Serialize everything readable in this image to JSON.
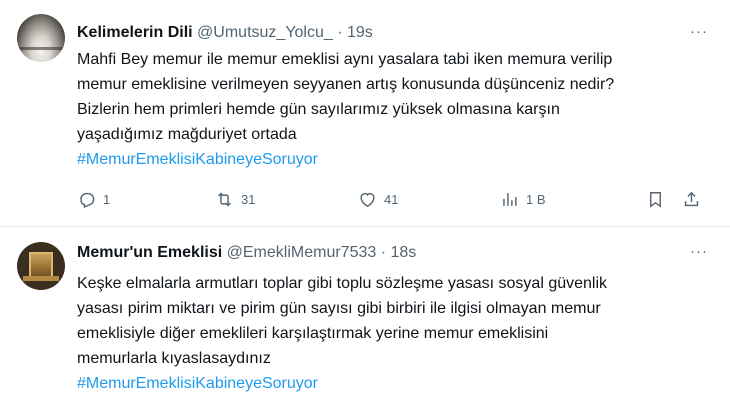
{
  "tweets": [
    {
      "name": "Kelimelerin Dili",
      "handle": "@Umutsuz_Yolcu_",
      "separator": "·",
      "time": "19s",
      "more": "···",
      "lines": [
        "Mahfi Bey memur ile memur emeklisi aynı yasalara tabi iken memura verilip",
        "memur emeklisine verilmeyen seyyanen artış konusunda düşünceniz nedir?",
        "Bizlerin hem primleri hemde gün sayılarımız yüksek olmasına karşın",
        "yaşadığımız mağduriyet ortada"
      ],
      "hashtag": "#MemurEmeklisiKabineyeSoruyor",
      "actions": {
        "replies": "1",
        "retweets": "31",
        "likes": "41",
        "views": "1 B"
      },
      "icons": [
        "reply-icon",
        "retweet-icon",
        "like-icon",
        "views-icon",
        "bookmark-icon",
        "share-icon"
      ]
    },
    {
      "name": "Memur'un Emeklisi",
      "handle": "@EmekliMemur7533",
      "separator": "·",
      "time": "18s",
      "more": "···",
      "lines": [
        "Keşke elmalarla armutları toplar gibi toplu sözleşme yasası sosyal güvenlik",
        "yasası pirim miktarı ve pirim gün sayısı gibi birbiri ile ilgisi olmayan memur",
        "emeklisiyle diğer emeklileri karşılaştırmak yerine memur emeklisini",
        "memurlarla kıyaslasaydınız"
      ],
      "hashtag": "#MemurEmeklisiKabineyeSoruyor"
    }
  ],
  "colors": {
    "text": "#0f1419",
    "secondary": "#536471",
    "link": "#1d9bf0",
    "divider": "#e7e9ea"
  }
}
